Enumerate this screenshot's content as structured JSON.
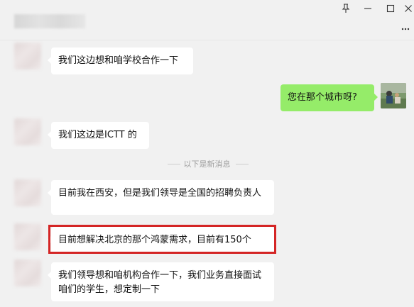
{
  "window": {
    "pin_icon": "pin-icon",
    "minimize_icon": "minimize-icon",
    "maximize_icon": "maximize-icon",
    "close_icon": "close-icon",
    "more_icon": "more-icon"
  },
  "messages": [
    {
      "side": "left",
      "text": "我们这边想和咱学校合作一下"
    },
    {
      "side": "right",
      "text": "您在那个城市呀?"
    },
    {
      "side": "left",
      "text": "我们这边是ICTT 的"
    },
    {
      "side": "system",
      "text": "以下是新消息"
    },
    {
      "side": "left",
      "text": "目前我在西安，但是我们领导是全国的招聘负责人"
    },
    {
      "side": "left",
      "text": "目前想解决北京的那个鸿蒙需求，目前有150个",
      "highlighted": true
    },
    {
      "side": "left",
      "text": "我们领导想和咱机构合作一下，我们业务直接面试咱们的学生，想定制一下"
    }
  ],
  "colors": {
    "background": "#f1f1f1",
    "bubble_incoming": "#ffffff",
    "bubble_outgoing": "#95ec69",
    "highlight_border": "#d42525",
    "system_text": "#a0a0a0"
  }
}
